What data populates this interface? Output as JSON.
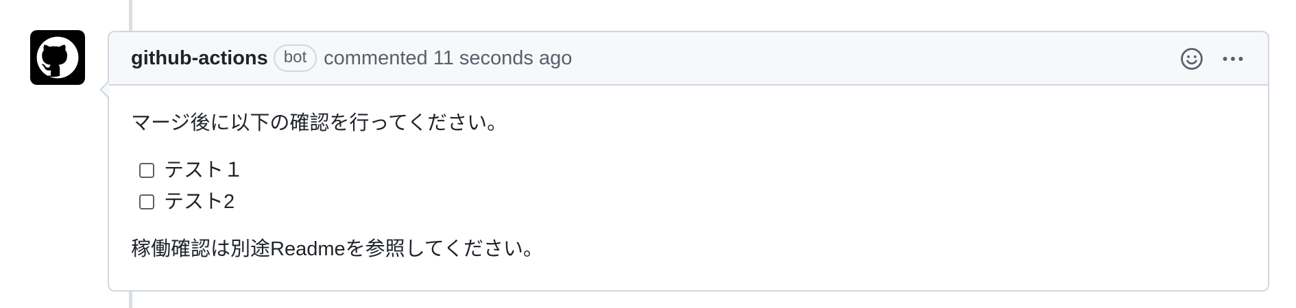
{
  "comment": {
    "author": "github-actions",
    "badge": "bot",
    "timestamp": "commented 11 seconds ago",
    "intro": "マージ後に以下の確認を行ってください。",
    "tasks": [
      {
        "label": "テスト１",
        "checked": false
      },
      {
        "label": "テスト2",
        "checked": false
      }
    ],
    "footer": "稼働確認は別途Readmeを参照してください。"
  },
  "icons": {
    "avatar": "github-mark-icon",
    "reaction": "smiley-icon",
    "more": "kebab-horizontal-icon"
  },
  "colors": {
    "header_bg": "#f6f8fa",
    "border": "#d0d7de",
    "muted_text": "#57606a",
    "avatar_bg": "#000000"
  }
}
